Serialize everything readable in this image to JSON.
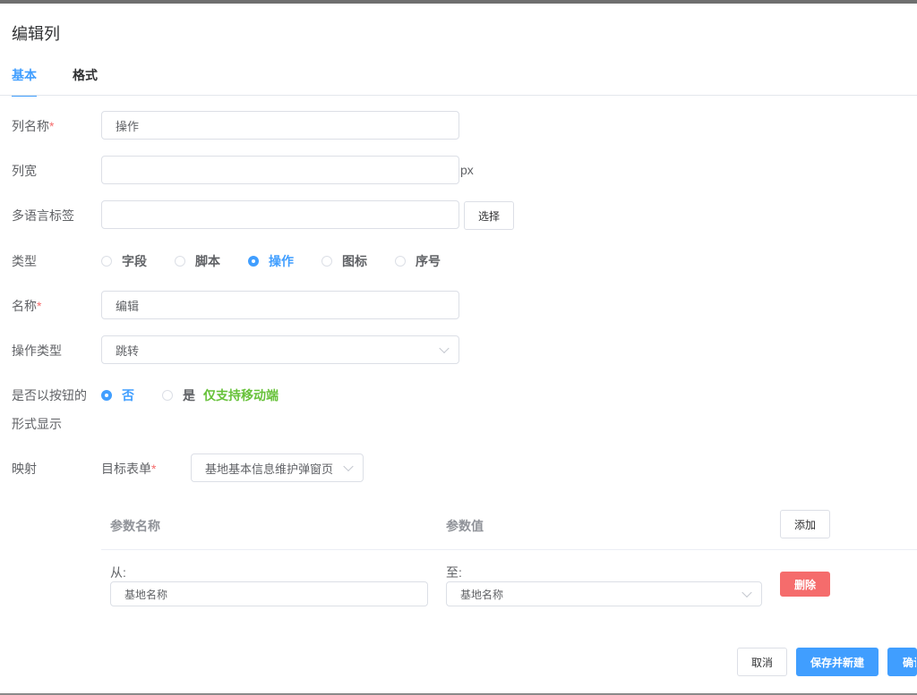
{
  "dialog": {
    "title": "编辑列"
  },
  "tabs": [
    {
      "label": "基本"
    },
    {
      "label": "格式"
    }
  ],
  "form": {
    "column_name": {
      "label": "列名称",
      "required_mark": "*",
      "value": "操作"
    },
    "column_width": {
      "label": "列宽",
      "value": "",
      "unit": "px"
    },
    "i18n_label": {
      "label": "多语言标签",
      "value": "",
      "select_button": "选择"
    },
    "type": {
      "label": "类型",
      "options": [
        "字段",
        "脚本",
        "操作",
        "图标",
        "序号"
      ],
      "selected": "操作"
    },
    "name": {
      "label": "名称",
      "required_mark": "*",
      "value": "编辑"
    },
    "action_type": {
      "label": "操作类型",
      "value": "跳转"
    },
    "show_as_button": {
      "label_line1": "是否以按钮的",
      "label_line2": "形式显示",
      "options": [
        "否",
        "是"
      ],
      "selected": "否",
      "hint": "仅支持移动端"
    },
    "mapping": {
      "label": "映射",
      "target_form_label": "目标表单",
      "required_mark": "*",
      "target_form_value": "基地基本信息维护弹窗页"
    }
  },
  "param_table": {
    "headers": [
      "参数名称",
      "参数值"
    ],
    "add_button": "添加",
    "rows": [
      {
        "from_label": "从:",
        "from_value": "基地名称",
        "to_label": "至:",
        "to_value": "基地名称",
        "delete_button": "删除"
      }
    ]
  },
  "footer": {
    "cancel": "取消",
    "save_new": "保存并新建",
    "confirm": "确认"
  },
  "colors": {
    "primary": "#409eff",
    "danger": "#f56c6c",
    "success": "#67c23a"
  }
}
